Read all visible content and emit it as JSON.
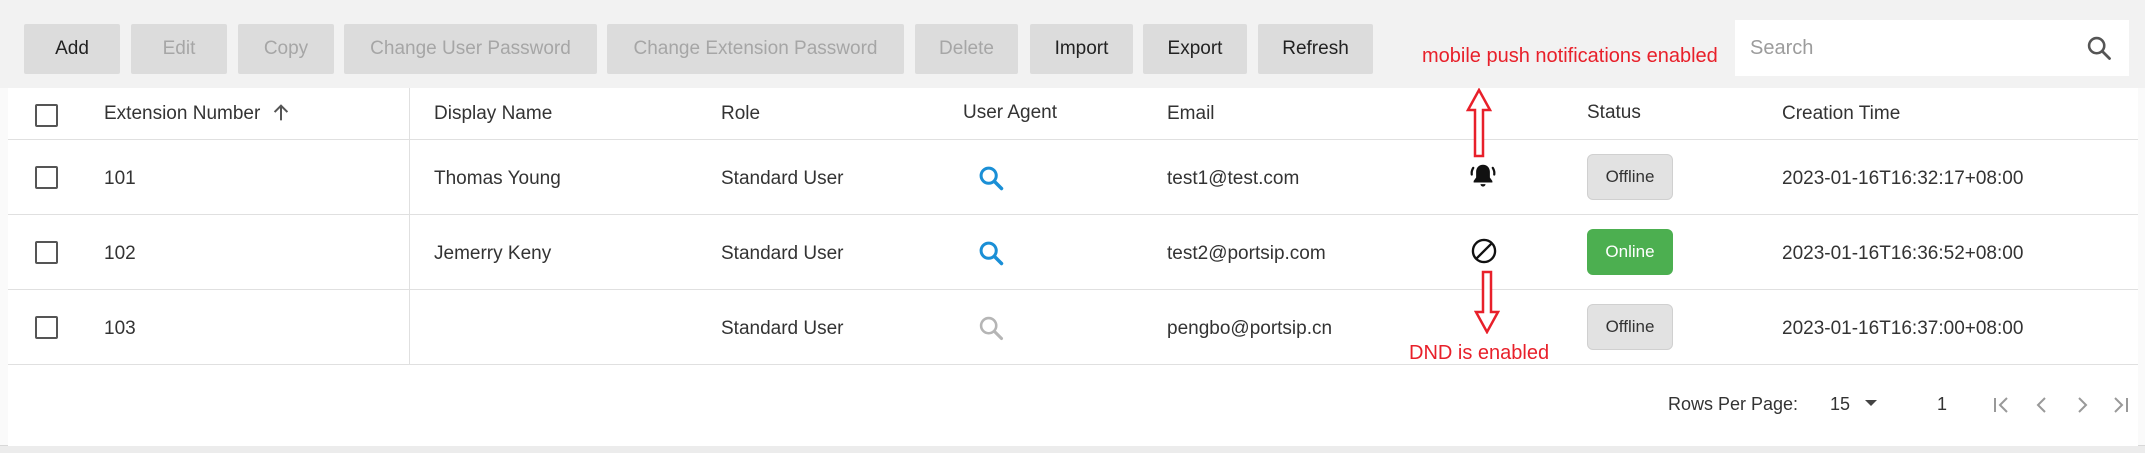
{
  "toolbar": {
    "add": "Add",
    "edit": "Edit",
    "copy": "Copy",
    "change_user_password": "Change User Password",
    "change_extension_password": "Change Extension Password",
    "delete": "Delete",
    "import": "Import",
    "export": "Export",
    "refresh": "Refresh"
  },
  "search": {
    "placeholder": "Search"
  },
  "table": {
    "headers": {
      "extension_number": "Extension Number",
      "display_name": "Display Name",
      "role": "Role",
      "user_agent": "User Agent",
      "email": "Email",
      "status": "Status",
      "creation_time": "Creation Time"
    },
    "sort_indicator": "ascending",
    "rows": [
      {
        "ext": "101",
        "name": "Thomas Young",
        "role": "Standard User",
        "user_agent_icon": "search-icon-active",
        "email": "test1@test.com",
        "flag_icon": "bell-icon",
        "status": "Offline",
        "created": "2023-01-16T16:32:17+08:00"
      },
      {
        "ext": "102",
        "name": "Jemerry Keny",
        "role": "Standard User",
        "user_agent_icon": "search-icon-active",
        "email": "test2@portsip.com",
        "flag_icon": "do-not-disturb-icon",
        "status": "Online",
        "created": "2023-01-16T16:36:52+08:00"
      },
      {
        "ext": "103",
        "name": "",
        "role": "Standard User",
        "user_agent_icon": "search-icon-inactive",
        "email": "pengbo@portsip.cn",
        "flag_icon": "",
        "status": "Offline",
        "created": "2023-01-16T16:37:00+08:00"
      }
    ]
  },
  "pagination": {
    "rows_per_page_label": "Rows Per Page:",
    "rows_per_page": "15",
    "page": "1"
  },
  "annotations": {
    "push": "mobile push notifications enabled",
    "dnd": "DND is enabled"
  },
  "colors": {
    "accent_blue": "#1a8fd6",
    "online_green": "#4caf50",
    "annotation_red": "#e8202a"
  }
}
